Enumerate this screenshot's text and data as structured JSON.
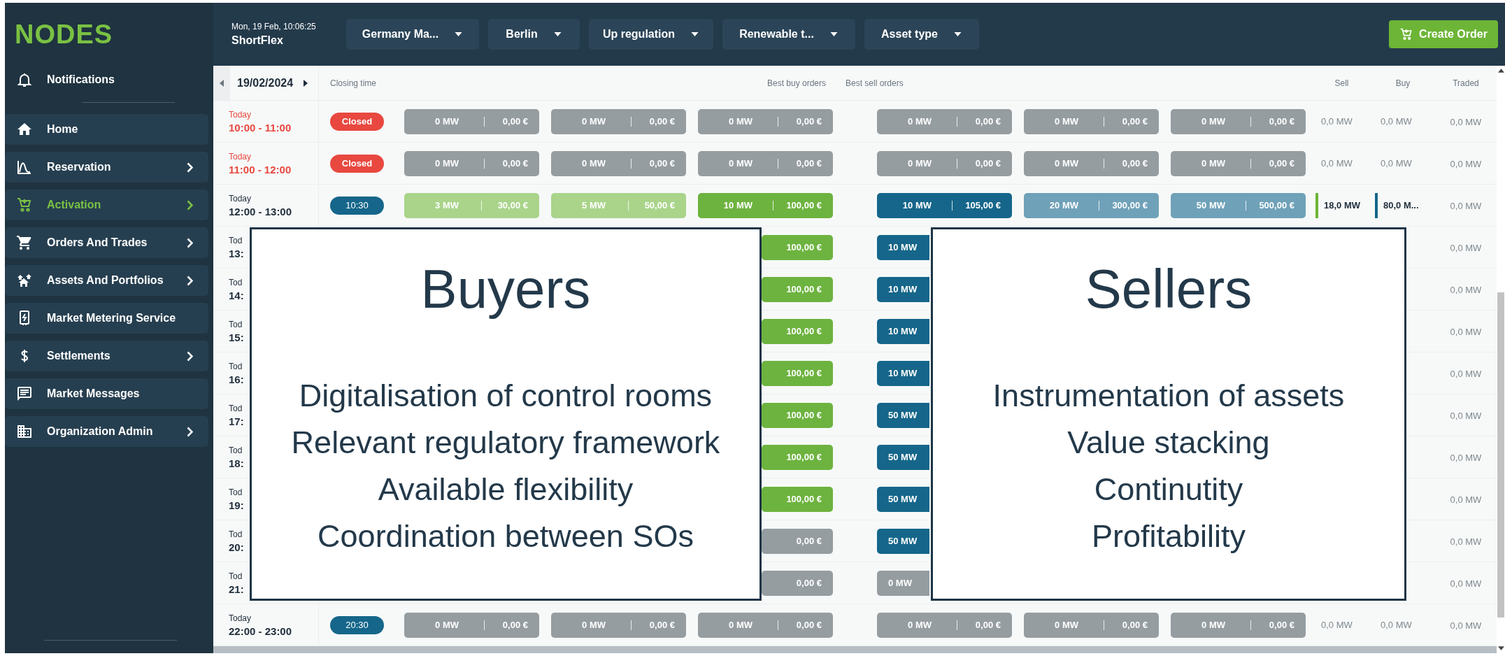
{
  "app": {
    "logo": "NODES",
    "timestamp": "Mon, 19 Feb, 10:06:25",
    "product": "ShortFlex"
  },
  "filters": [
    "Germany Ma...",
    "Berlin",
    "Up regulation",
    "Renewable t...",
    "Asset type"
  ],
  "create_button": "Create Order",
  "sidebar": {
    "notifications": "Notifications",
    "items": [
      {
        "label": "Home",
        "has_submenu": false,
        "selected": false
      },
      {
        "label": "Reservation",
        "has_submenu": true,
        "selected": false
      },
      {
        "label": "Activation",
        "has_submenu": true,
        "selected": true
      },
      {
        "label": "Orders And Trades",
        "has_submenu": true,
        "selected": false
      },
      {
        "label": "Assets And Portfolios",
        "has_submenu": true,
        "selected": false
      },
      {
        "label": "Market Metering Service",
        "has_submenu": false,
        "selected": false
      },
      {
        "label": "Settlements",
        "has_submenu": true,
        "selected": false
      },
      {
        "label": "Market Messages",
        "has_submenu": false,
        "selected": false
      },
      {
        "label": "Organization Admin",
        "has_submenu": true,
        "selected": false
      }
    ]
  },
  "table": {
    "date": "19/02/2024",
    "columns": {
      "closing": "Closing time",
      "best_buy": "Best buy orders",
      "best_sell": "Best sell orders",
      "sell": "Sell",
      "buy": "Buy",
      "traded": "Traded"
    },
    "rows": [
      {
        "day": "Today",
        "range": "10:00 - 11:00",
        "past": true,
        "closing": {
          "label": "Closed",
          "kind": "closed"
        },
        "buy": [
          {
            "mw": "0 MW",
            "price": "0,00 €",
            "kind": "none"
          },
          {
            "mw": "0 MW",
            "price": "0,00 €",
            "kind": "none"
          },
          {
            "mw": "0 MW",
            "price": "0,00 €",
            "kind": "none"
          }
        ],
        "sell": [
          {
            "mw": "0 MW",
            "price": "0,00 €",
            "kind": "none"
          },
          {
            "mw": "0 MW",
            "price": "0,00 €",
            "kind": "none"
          },
          {
            "mw": "0 MW",
            "price": "0,00 €",
            "kind": "none"
          }
        ],
        "sell_total": {
          "value": "0,0 MW",
          "active": false
        },
        "buy_total": {
          "value": "0,0 MW",
          "active": false
        },
        "traded": "0,0 MW"
      },
      {
        "day": "Today",
        "range": "11:00 - 12:00",
        "past": true,
        "closing": {
          "label": "Closed",
          "kind": "closed"
        },
        "buy": [
          {
            "mw": "0 MW",
            "price": "0,00 €",
            "kind": "none"
          },
          {
            "mw": "0 MW",
            "price": "0,00 €",
            "kind": "none"
          },
          {
            "mw": "0 MW",
            "price": "0,00 €",
            "kind": "none"
          }
        ],
        "sell": [
          {
            "mw": "0 MW",
            "price": "0,00 €",
            "kind": "none"
          },
          {
            "mw": "0 MW",
            "price": "0,00 €",
            "kind": "none"
          },
          {
            "mw": "0 MW",
            "price": "0,00 €",
            "kind": "none"
          }
        ],
        "sell_total": {
          "value": "0,0 MW",
          "active": false
        },
        "buy_total": {
          "value": "0,0 MW",
          "active": false
        },
        "traded": "0,0 MW"
      },
      {
        "day": "Today",
        "range": "12:00 - 13:00",
        "past": false,
        "closing": {
          "label": "10:30",
          "kind": "open"
        },
        "buy": [
          {
            "mw": "3 MW",
            "price": "30,00 €",
            "kind": "partial"
          },
          {
            "mw": "5 MW",
            "price": "50,00 €",
            "kind": "partial"
          },
          {
            "mw": "10 MW",
            "price": "100,00 €",
            "kind": "best"
          }
        ],
        "sell": [
          {
            "mw": "10 MW",
            "price": "105,00 €",
            "kind": "best"
          },
          {
            "mw": "20 MW",
            "price": "300,00 €",
            "kind": "partial"
          },
          {
            "mw": "50 MW",
            "price": "500,00 €",
            "kind": "partial"
          }
        ],
        "sell_total": {
          "value": "18,0 MW",
          "active": true
        },
        "buy_total": {
          "value": "80,0 M...",
          "active": true
        },
        "traded": "0,0 MW"
      },
      {
        "day": "Tod",
        "range": "13:",
        "past": false,
        "buy_3": {
          "price": "100,00 €",
          "kind": "best"
        },
        "sell_1": {
          "mw": "10 MW",
          "kind": "best"
        },
        "traded": "0,0 MW"
      },
      {
        "day": "Tod",
        "range": "14:",
        "past": false,
        "buy_3": {
          "price": "100,00 €",
          "kind": "best"
        },
        "sell_1": {
          "mw": "10 MW",
          "kind": "best"
        },
        "traded": "0,0 MW"
      },
      {
        "day": "Tod",
        "range": "15:",
        "past": false,
        "buy_3": {
          "price": "100,00 €",
          "kind": "best"
        },
        "sell_1": {
          "mw": "10 MW",
          "kind": "best"
        },
        "traded": "0,0 MW"
      },
      {
        "day": "Tod",
        "range": "16:",
        "past": false,
        "buy_3": {
          "price": "100,00 €",
          "kind": "best"
        },
        "sell_1": {
          "mw": "10 MW",
          "kind": "best"
        },
        "traded": "0,0 MW"
      },
      {
        "day": "Tod",
        "range": "17:",
        "past": false,
        "buy_3": {
          "price": "100,00 €",
          "kind": "best"
        },
        "sell_1": {
          "mw": "50 MW",
          "kind": "best"
        },
        "traded": "0,0 MW"
      },
      {
        "day": "Tod",
        "range": "18:",
        "past": false,
        "buy_3": {
          "price": "100,00 €",
          "kind": "best"
        },
        "sell_1": {
          "mw": "50 MW",
          "kind": "best"
        },
        "traded": "0,0 MW"
      },
      {
        "day": "Tod",
        "range": "19:",
        "past": false,
        "buy_3": {
          "price": "100,00 €",
          "kind": "best"
        },
        "sell_1": {
          "mw": "50 MW",
          "kind": "best"
        },
        "traded": "0,0 MW"
      },
      {
        "day": "Tod",
        "range": "20:",
        "past": false,
        "buy_3": {
          "price": "0,00 €",
          "kind": "none"
        },
        "sell_1": {
          "mw": "50 MW",
          "kind": "best"
        },
        "traded": "0,0 MW"
      },
      {
        "day": "Tod",
        "range": "21:",
        "past": false,
        "buy_3": {
          "price": "0,00 €",
          "kind": "none"
        },
        "sell_1": {
          "mw": "0 MW",
          "kind": "none"
        },
        "traded": "0,0 MW"
      },
      {
        "day": "Today",
        "range": "22:00 - 23:00",
        "past": false,
        "closing": {
          "label": "20:30",
          "kind": "open"
        },
        "buy": [
          {
            "mw": "0 MW",
            "price": "0,00 €",
            "kind": "none"
          },
          {
            "mw": "0 MW",
            "price": "0,00 €",
            "kind": "none"
          },
          {
            "mw": "0 MW",
            "price": "0,00 €",
            "kind": "none"
          }
        ],
        "sell": [
          {
            "mw": "0 MW",
            "price": "0,00 €",
            "kind": "none"
          },
          {
            "mw": "0 MW",
            "price": "0,00 €",
            "kind": "none"
          },
          {
            "mw": "0 MW",
            "price": "0,00 €",
            "kind": "none"
          }
        ],
        "sell_total": {
          "value": "0,0 MW",
          "active": false
        },
        "buy_total": {
          "value": "0,0 MW",
          "active": false
        },
        "traded": "0,0 MW"
      }
    ]
  },
  "panels": [
    {
      "title": "Buyers",
      "points": [
        "Digitalisation of control rooms",
        "Relevant regulatory framework",
        "Available flexibility",
        "Coordination between SOs"
      ]
    },
    {
      "title": "Sellers",
      "points": [
        "Instrumentation of assets",
        "Value stacking",
        "Continutity",
        "Profitability"
      ]
    }
  ]
}
